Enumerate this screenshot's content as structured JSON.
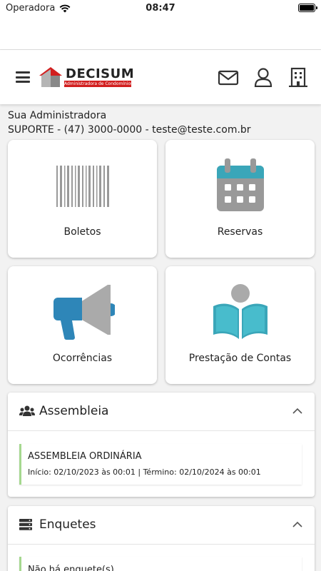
{
  "status_bar": {
    "carrier": "Operadora",
    "time": "08:47"
  },
  "header": {
    "logo_text": "DECISUM",
    "logo_subtitle": "Administradora de Condomínios",
    "icons": [
      "menu-icon",
      "mail-icon",
      "user-icon",
      "building-icon"
    ]
  },
  "admin": {
    "title": "Sua Administradora",
    "contact": "SUPORTE - (47) 3000-0000 - teste@teste.com.br"
  },
  "tiles": [
    {
      "label": "Boletos",
      "icon": "barcode-icon"
    },
    {
      "label": "Reservas",
      "icon": "calendar-icon"
    },
    {
      "label": "Ocorrências",
      "icon": "megaphone-icon"
    },
    {
      "label": "Prestação de Contas",
      "icon": "reader-icon"
    }
  ],
  "assembleia": {
    "title": "Assembleia",
    "item_title": "ASSEMBLEIA ORDINÁRIA",
    "item_dates": "Início: 02/10/2023 às 00:01 | Término: 02/10/2024 às 00:01"
  },
  "enquetes": {
    "title": "Enquetes",
    "empty_text": "Não há enquete(s)"
  },
  "colors": {
    "accent_red": "#d21f1f",
    "teal": "#3aa6b9",
    "entry_border": "#a5d88f"
  }
}
